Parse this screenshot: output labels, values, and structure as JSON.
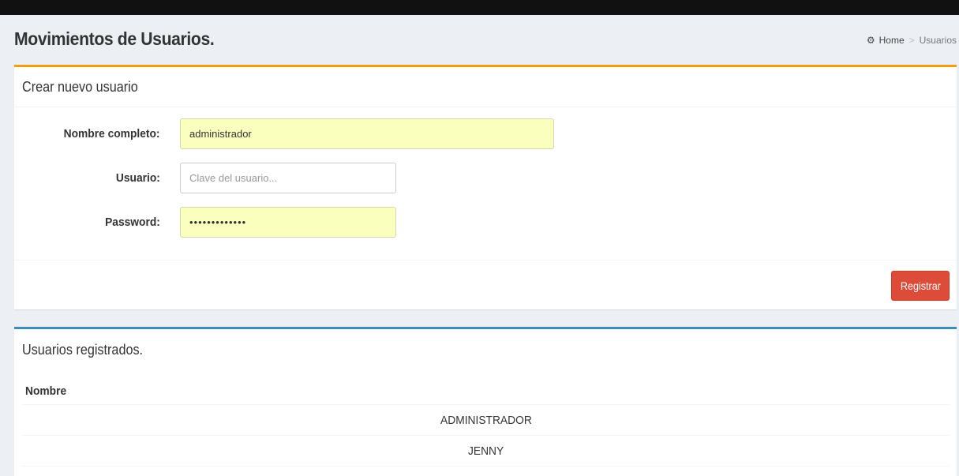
{
  "page": {
    "title": "Movimientos de Usuarios."
  },
  "breadcrumb": {
    "home_icon": "dashboard-icon",
    "home_label": "Home",
    "separator": ">",
    "current": "Usuarios"
  },
  "form": {
    "header": "Crear nuevo usuario",
    "fields": {
      "nombre": {
        "label": "Nombre completo:",
        "value": "administrador",
        "placeholder": ""
      },
      "usuario": {
        "label": "Usuario:",
        "value": "",
        "placeholder": "Clave del usuario..."
      },
      "password": {
        "label": "Password:",
        "value": "administrador"
      }
    },
    "submit_label": "Registrar"
  },
  "list": {
    "header": "Usuarios registrados.",
    "columns": [
      "Nombre"
    ],
    "rows": [
      {
        "nombre": "ADMINISTRADOR"
      },
      {
        "nombre": "JENNY"
      }
    ]
  },
  "colors": {
    "form_box_accent": "#f39c12",
    "list_box_accent": "#3c8dbc",
    "button_danger": "#dd4b39",
    "autofill_bg": "#faffbd"
  }
}
